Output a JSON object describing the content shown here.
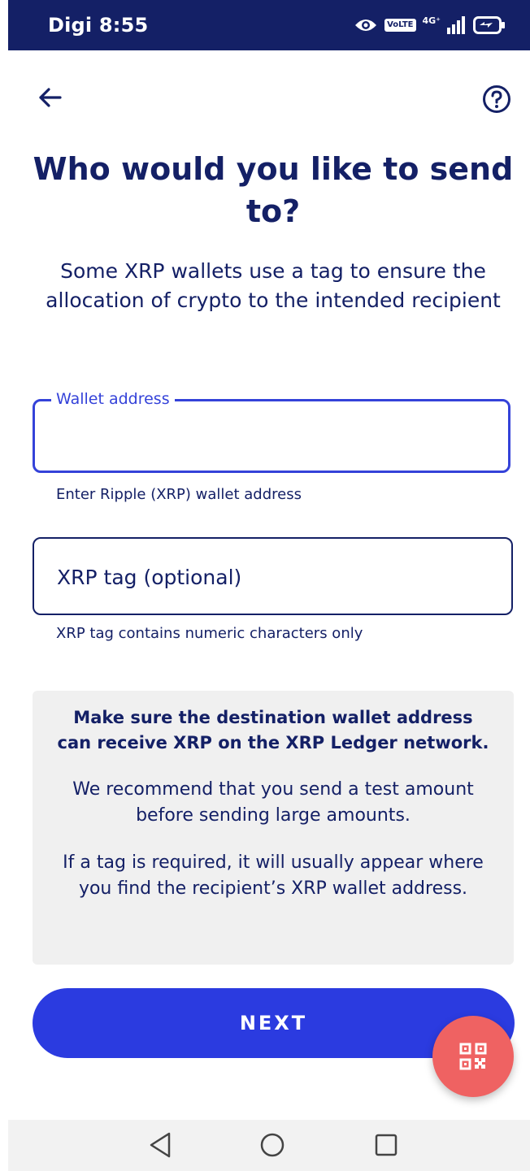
{
  "status_bar": {
    "carrier_time": "Digi 8:55",
    "volte": "VoLTE",
    "network": "4G⁺",
    "icons": [
      "eye-icon",
      "volte-icon",
      "signal-icon",
      "battery-charging-icon"
    ]
  },
  "header": {
    "back_icon": "arrow-left-icon",
    "help_icon": "question-circle-icon"
  },
  "title": "Who would you like to send to?",
  "subtitle": "Some XRP wallets use a tag to ensure the allocation of crypto to the intended recipient",
  "wallet_field": {
    "label": "Wallet address",
    "value": "",
    "helper": "Enter Ripple (XRP) wallet address"
  },
  "tag_field": {
    "placeholder": "XRP tag (optional)",
    "value": "",
    "helper": "XRP tag contains numeric characters only"
  },
  "info": {
    "warning": "Make sure the destination wallet address can receive XRP on the XRP Ledger network.",
    "recommend": "We recommend that you send a test amount before sending large amounts.",
    "tag_note": "If a tag is required, it will usually appear where you find the recipient’s XRP wallet address."
  },
  "next_button": "NEXT",
  "qr_fab_icon": "qr-code-icon",
  "nav": {
    "back_icon": "triangle-back-icon",
    "home_icon": "circle-home-icon",
    "recent_icon": "square-recents-icon"
  },
  "colors": {
    "brand_navy": "#142066",
    "accent_blue": "#2b3be0",
    "field_focus": "#3442d9",
    "fab_red": "#ef6262",
    "info_bg": "#f0f0f0"
  }
}
